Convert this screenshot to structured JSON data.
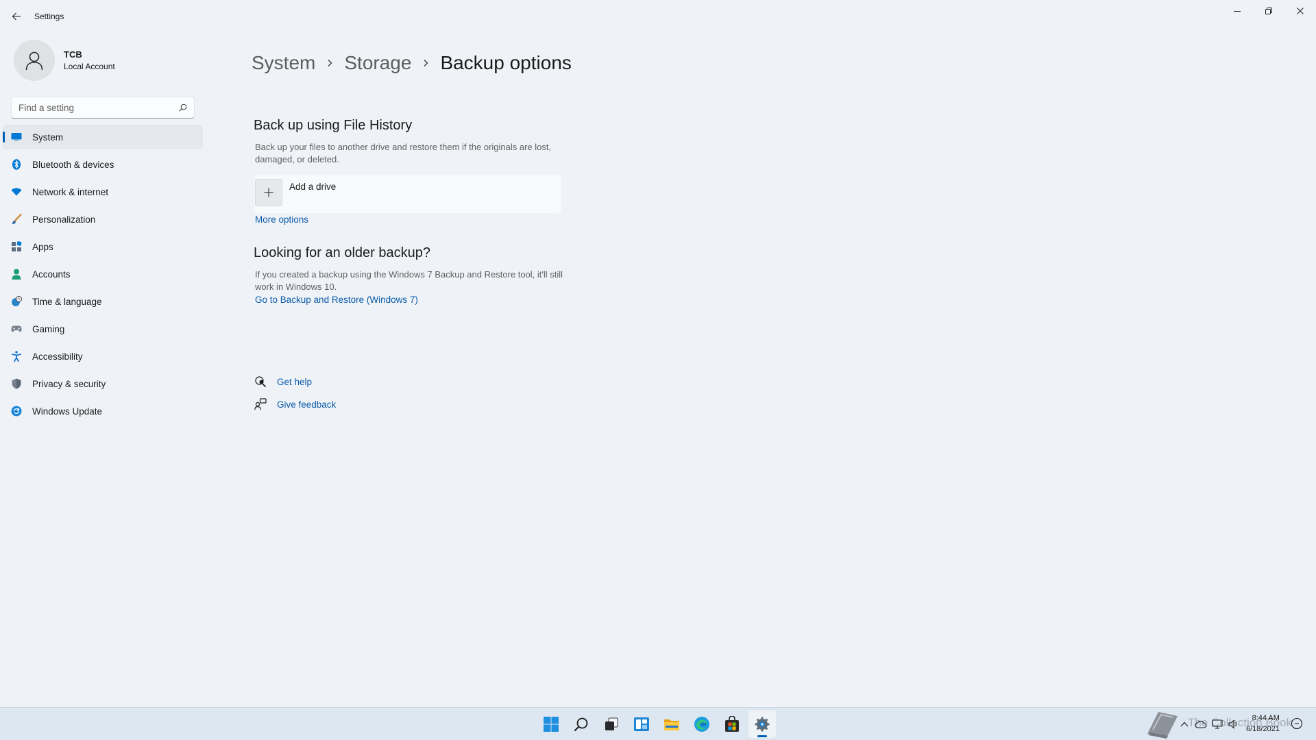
{
  "window": {
    "title": "Settings",
    "controls": [
      "minimize",
      "restore",
      "close"
    ]
  },
  "profile": {
    "name": "TCB",
    "account_type": "Local Account"
  },
  "search": {
    "placeholder": "Find a setting"
  },
  "sidebar": {
    "items": [
      {
        "label": "System",
        "icon": "monitor-icon",
        "active": true
      },
      {
        "label": "Bluetooth & devices",
        "icon": "bluetooth-icon"
      },
      {
        "label": "Network & internet",
        "icon": "wifi-icon"
      },
      {
        "label": "Personalization",
        "icon": "brush-icon"
      },
      {
        "label": "Apps",
        "icon": "apps-icon"
      },
      {
        "label": "Accounts",
        "icon": "person-icon"
      },
      {
        "label": "Time & language",
        "icon": "globe-clock-icon"
      },
      {
        "label": "Gaming",
        "icon": "gamepad-icon"
      },
      {
        "label": "Accessibility",
        "icon": "accessibility-icon"
      },
      {
        "label": "Privacy & security",
        "icon": "shield-icon"
      },
      {
        "label": "Windows Update",
        "icon": "refresh-icon"
      }
    ]
  },
  "breadcrumb": {
    "items": [
      "System",
      "Storage"
    ],
    "current": "Backup options"
  },
  "file_history": {
    "title": "Back up using File History",
    "description": "Back up your files to another drive and restore them if the originals are lost, damaged, or deleted.",
    "add_drive_label": "Add a drive",
    "more_options": "More options"
  },
  "older_backup": {
    "title": "Looking for an older backup?",
    "description": "If you created a backup using the Windows 7 Backup and Restore tool, it'll still work in Windows 10.",
    "link": "Go to Backup and Restore (Windows 7)"
  },
  "help": {
    "get_help": "Get help",
    "give_feedback": "Give feedback"
  },
  "taskbar": {
    "apps": [
      "start-icon",
      "search-icon",
      "task-view-icon",
      "widgets-icon",
      "file-explorer-icon",
      "edge-icon",
      "store-icon",
      "settings-icon"
    ],
    "active_app": "settings-icon",
    "tray": [
      "chevron-up-icon",
      "cloud-icon",
      "network-icon",
      "volume-icon"
    ],
    "time": "8:44 AM",
    "date": "6/18/2021",
    "watermark_text": "The Collection Book"
  },
  "colors": {
    "accent": "#005fb8",
    "link": "#0a5aa8",
    "window_bg": "#eff3f8",
    "taskbar_bg": "#dde7f1"
  }
}
